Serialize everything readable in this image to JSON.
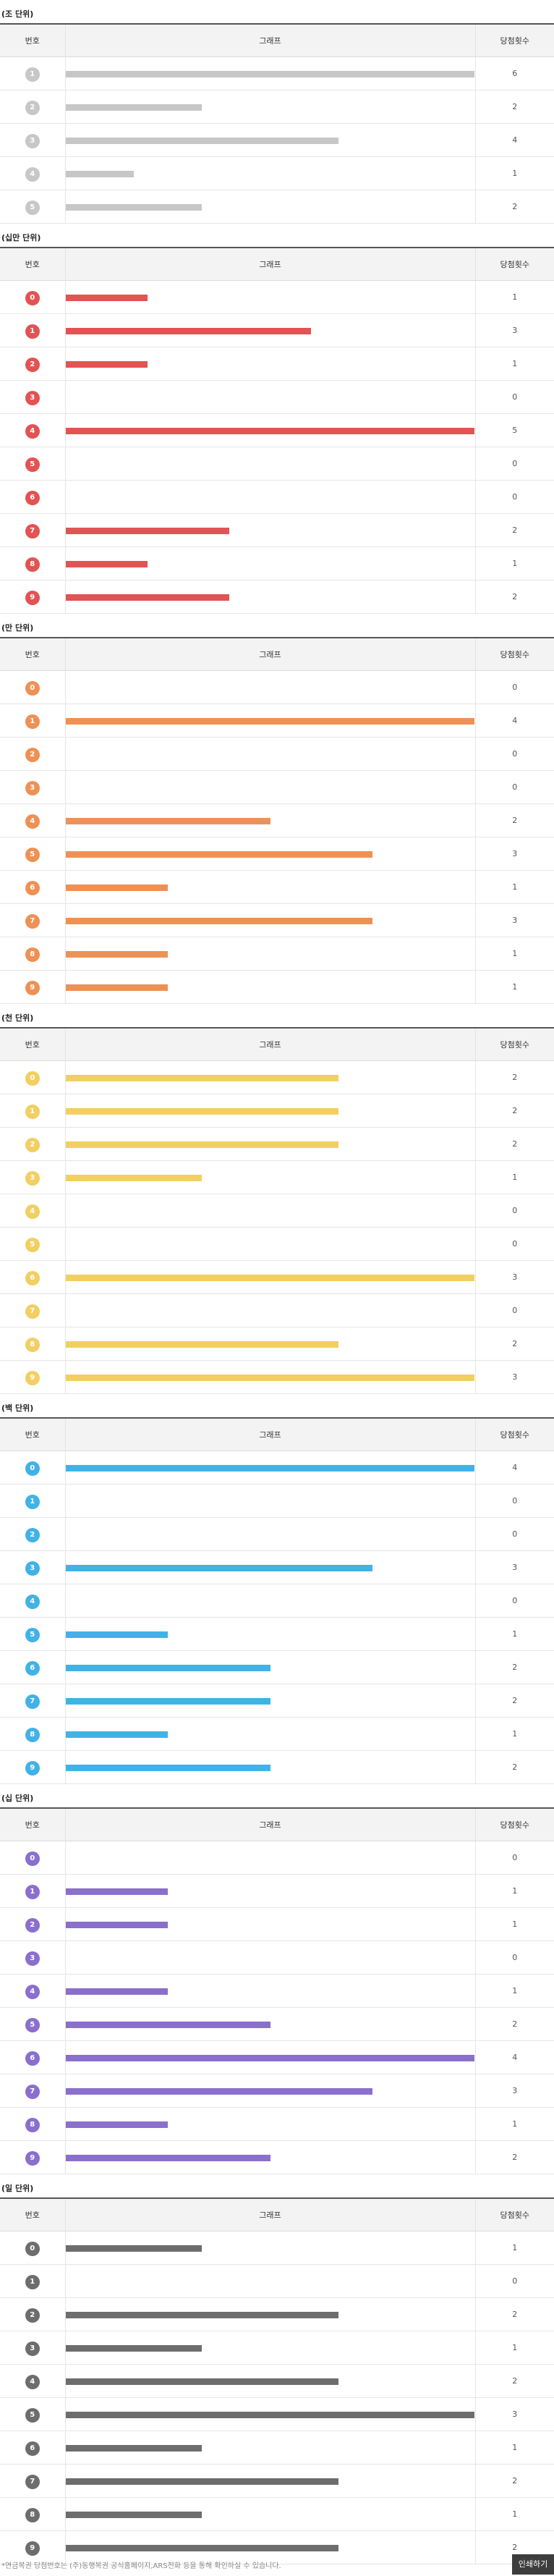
{
  "header_labels": {
    "num": "번호",
    "graph": "그래프",
    "count": "당첨횟수"
  },
  "chart_data": [
    {
      "type": "bar",
      "title": "(조 단위)",
      "color": "#c7c7c7",
      "categories": [
        "1",
        "2",
        "3",
        "4",
        "5"
      ],
      "values": [
        6,
        2,
        4,
        1,
        2
      ],
      "xlim": [
        0,
        6
      ]
    },
    {
      "type": "bar",
      "title": "(십만 단위)",
      "color": "#e25353",
      "categories": [
        "0",
        "1",
        "2",
        "3",
        "4",
        "5",
        "6",
        "7",
        "8",
        "9"
      ],
      "values": [
        1,
        3,
        1,
        0,
        5,
        0,
        0,
        2,
        1,
        2
      ],
      "xlim": [
        0,
        5
      ]
    },
    {
      "type": "bar",
      "title": "(만 단위)",
      "color": "#ee9155",
      "categories": [
        "0",
        "1",
        "2",
        "3",
        "4",
        "5",
        "6",
        "7",
        "8",
        "9"
      ],
      "values": [
        0,
        4,
        0,
        0,
        2,
        3,
        1,
        3,
        1,
        1
      ],
      "xlim": [
        0,
        4
      ]
    },
    {
      "type": "bar",
      "title": "(천 단위)",
      "color": "#f2cf62",
      "categories": [
        "0",
        "1",
        "2",
        "3",
        "4",
        "5",
        "6",
        "7",
        "8",
        "9"
      ],
      "values": [
        2,
        2,
        2,
        1,
        0,
        0,
        3,
        0,
        2,
        3
      ],
      "xlim": [
        0,
        3
      ]
    },
    {
      "type": "bar",
      "title": "(백 단위)",
      "color": "#41b2e6",
      "categories": [
        "0",
        "1",
        "2",
        "3",
        "4",
        "5",
        "6",
        "7",
        "8",
        "9"
      ],
      "values": [
        4,
        0,
        0,
        3,
        0,
        1,
        2,
        2,
        1,
        2
      ],
      "xlim": [
        0,
        4
      ]
    },
    {
      "type": "bar",
      "title": "(십 단위)",
      "color": "#8a6fcd",
      "categories": [
        "0",
        "1",
        "2",
        "3",
        "4",
        "5",
        "6",
        "7",
        "8",
        "9"
      ],
      "values": [
        0,
        1,
        1,
        0,
        1,
        2,
        4,
        3,
        1,
        2
      ],
      "xlim": [
        0,
        4
      ]
    },
    {
      "type": "bar",
      "title": "(일 단위)",
      "color": "#6d6d6d",
      "categories": [
        "0",
        "1",
        "2",
        "3",
        "4",
        "5",
        "6",
        "7",
        "8",
        "9"
      ],
      "values": [
        1,
        0,
        2,
        1,
        2,
        3,
        1,
        2,
        1,
        2
      ],
      "xlim": [
        0,
        3
      ]
    }
  ],
  "footer": {
    "note": "*연금복권 당첨번호는 (주)동행복권 공식홈페이지,ARS전화 등을 통해 확인하실 수 있습니다.",
    "print_label": "인쇄하기"
  }
}
